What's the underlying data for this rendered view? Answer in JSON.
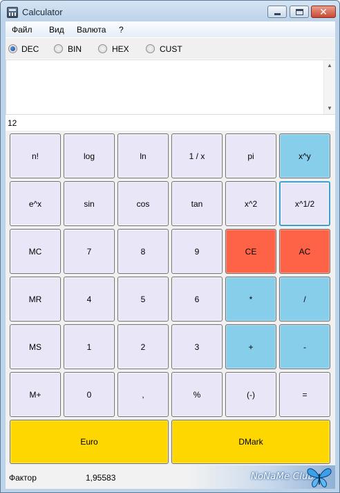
{
  "window": {
    "title": "Calculator"
  },
  "menu": {
    "items": [
      "Файл",
      "Вид",
      "Валюта",
      "?"
    ]
  },
  "modes": {
    "options": [
      "DEC",
      "BIN",
      "HEX",
      "CUST"
    ],
    "selected": "DEC"
  },
  "display": {
    "history": "",
    "result": "12"
  },
  "keys": {
    "row1": [
      "n!",
      "log",
      "ln",
      "1 / x",
      "pi",
      "x^y"
    ],
    "row2": [
      "e^x",
      "sin",
      "cos",
      "tan",
      "x^2",
      "x^1/2"
    ],
    "row3": [
      "MC",
      "7",
      "8",
      "9",
      "CE",
      "AC"
    ],
    "row4": [
      "MR",
      "4",
      "5",
      "6",
      "*",
      "/"
    ],
    "row5": [
      "MS",
      "1",
      "2",
      "3",
      "+",
      "-"
    ],
    "row6": [
      "M+",
      "0",
      ",",
      "%",
      "(-)",
      "="
    ],
    "row7": [
      "Euro",
      "DMark"
    ]
  },
  "status": {
    "label": "Фактор",
    "value": "1,95583",
    "watermark": "NoNaMe Club"
  },
  "colors": {
    "key_default": "#e9e7f7",
    "key_operator": "#87ceeb",
    "key_clear": "#ff6347",
    "key_currency": "#ffd700"
  }
}
